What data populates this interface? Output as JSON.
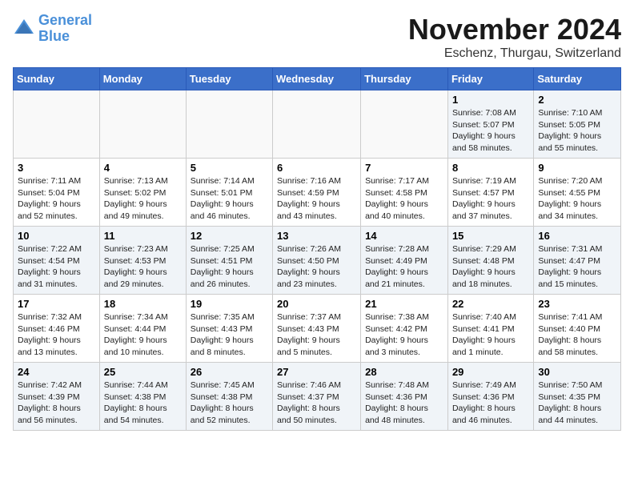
{
  "logo": {
    "line1": "General",
    "line2": "Blue"
  },
  "title": "November 2024",
  "location": "Eschenz, Thurgau, Switzerland",
  "days_of_week": [
    "Sunday",
    "Monday",
    "Tuesday",
    "Wednesday",
    "Thursday",
    "Friday",
    "Saturday"
  ],
  "weeks": [
    [
      {
        "day": "",
        "info": ""
      },
      {
        "day": "",
        "info": ""
      },
      {
        "day": "",
        "info": ""
      },
      {
        "day": "",
        "info": ""
      },
      {
        "day": "",
        "info": ""
      },
      {
        "day": "1",
        "info": "Sunrise: 7:08 AM\nSunset: 5:07 PM\nDaylight: 9 hours and 58 minutes."
      },
      {
        "day": "2",
        "info": "Sunrise: 7:10 AM\nSunset: 5:05 PM\nDaylight: 9 hours and 55 minutes."
      }
    ],
    [
      {
        "day": "3",
        "info": "Sunrise: 7:11 AM\nSunset: 5:04 PM\nDaylight: 9 hours and 52 minutes."
      },
      {
        "day": "4",
        "info": "Sunrise: 7:13 AM\nSunset: 5:02 PM\nDaylight: 9 hours and 49 minutes."
      },
      {
        "day": "5",
        "info": "Sunrise: 7:14 AM\nSunset: 5:01 PM\nDaylight: 9 hours and 46 minutes."
      },
      {
        "day": "6",
        "info": "Sunrise: 7:16 AM\nSunset: 4:59 PM\nDaylight: 9 hours and 43 minutes."
      },
      {
        "day": "7",
        "info": "Sunrise: 7:17 AM\nSunset: 4:58 PM\nDaylight: 9 hours and 40 minutes."
      },
      {
        "day": "8",
        "info": "Sunrise: 7:19 AM\nSunset: 4:57 PM\nDaylight: 9 hours and 37 minutes."
      },
      {
        "day": "9",
        "info": "Sunrise: 7:20 AM\nSunset: 4:55 PM\nDaylight: 9 hours and 34 minutes."
      }
    ],
    [
      {
        "day": "10",
        "info": "Sunrise: 7:22 AM\nSunset: 4:54 PM\nDaylight: 9 hours and 31 minutes."
      },
      {
        "day": "11",
        "info": "Sunrise: 7:23 AM\nSunset: 4:53 PM\nDaylight: 9 hours and 29 minutes."
      },
      {
        "day": "12",
        "info": "Sunrise: 7:25 AM\nSunset: 4:51 PM\nDaylight: 9 hours and 26 minutes."
      },
      {
        "day": "13",
        "info": "Sunrise: 7:26 AM\nSunset: 4:50 PM\nDaylight: 9 hours and 23 minutes."
      },
      {
        "day": "14",
        "info": "Sunrise: 7:28 AM\nSunset: 4:49 PM\nDaylight: 9 hours and 21 minutes."
      },
      {
        "day": "15",
        "info": "Sunrise: 7:29 AM\nSunset: 4:48 PM\nDaylight: 9 hours and 18 minutes."
      },
      {
        "day": "16",
        "info": "Sunrise: 7:31 AM\nSunset: 4:47 PM\nDaylight: 9 hours and 15 minutes."
      }
    ],
    [
      {
        "day": "17",
        "info": "Sunrise: 7:32 AM\nSunset: 4:46 PM\nDaylight: 9 hours and 13 minutes."
      },
      {
        "day": "18",
        "info": "Sunrise: 7:34 AM\nSunset: 4:44 PM\nDaylight: 9 hours and 10 minutes."
      },
      {
        "day": "19",
        "info": "Sunrise: 7:35 AM\nSunset: 4:43 PM\nDaylight: 9 hours and 8 minutes."
      },
      {
        "day": "20",
        "info": "Sunrise: 7:37 AM\nSunset: 4:43 PM\nDaylight: 9 hours and 5 minutes."
      },
      {
        "day": "21",
        "info": "Sunrise: 7:38 AM\nSunset: 4:42 PM\nDaylight: 9 hours and 3 minutes."
      },
      {
        "day": "22",
        "info": "Sunrise: 7:40 AM\nSunset: 4:41 PM\nDaylight: 9 hours and 1 minute."
      },
      {
        "day": "23",
        "info": "Sunrise: 7:41 AM\nSunset: 4:40 PM\nDaylight: 8 hours and 58 minutes."
      }
    ],
    [
      {
        "day": "24",
        "info": "Sunrise: 7:42 AM\nSunset: 4:39 PM\nDaylight: 8 hours and 56 minutes."
      },
      {
        "day": "25",
        "info": "Sunrise: 7:44 AM\nSunset: 4:38 PM\nDaylight: 8 hours and 54 minutes."
      },
      {
        "day": "26",
        "info": "Sunrise: 7:45 AM\nSunset: 4:38 PM\nDaylight: 8 hours and 52 minutes."
      },
      {
        "day": "27",
        "info": "Sunrise: 7:46 AM\nSunset: 4:37 PM\nDaylight: 8 hours and 50 minutes."
      },
      {
        "day": "28",
        "info": "Sunrise: 7:48 AM\nSunset: 4:36 PM\nDaylight: 8 hours and 48 minutes."
      },
      {
        "day": "29",
        "info": "Sunrise: 7:49 AM\nSunset: 4:36 PM\nDaylight: 8 hours and 46 minutes."
      },
      {
        "day": "30",
        "info": "Sunrise: 7:50 AM\nSunset: 4:35 PM\nDaylight: 8 hours and 44 minutes."
      }
    ]
  ]
}
